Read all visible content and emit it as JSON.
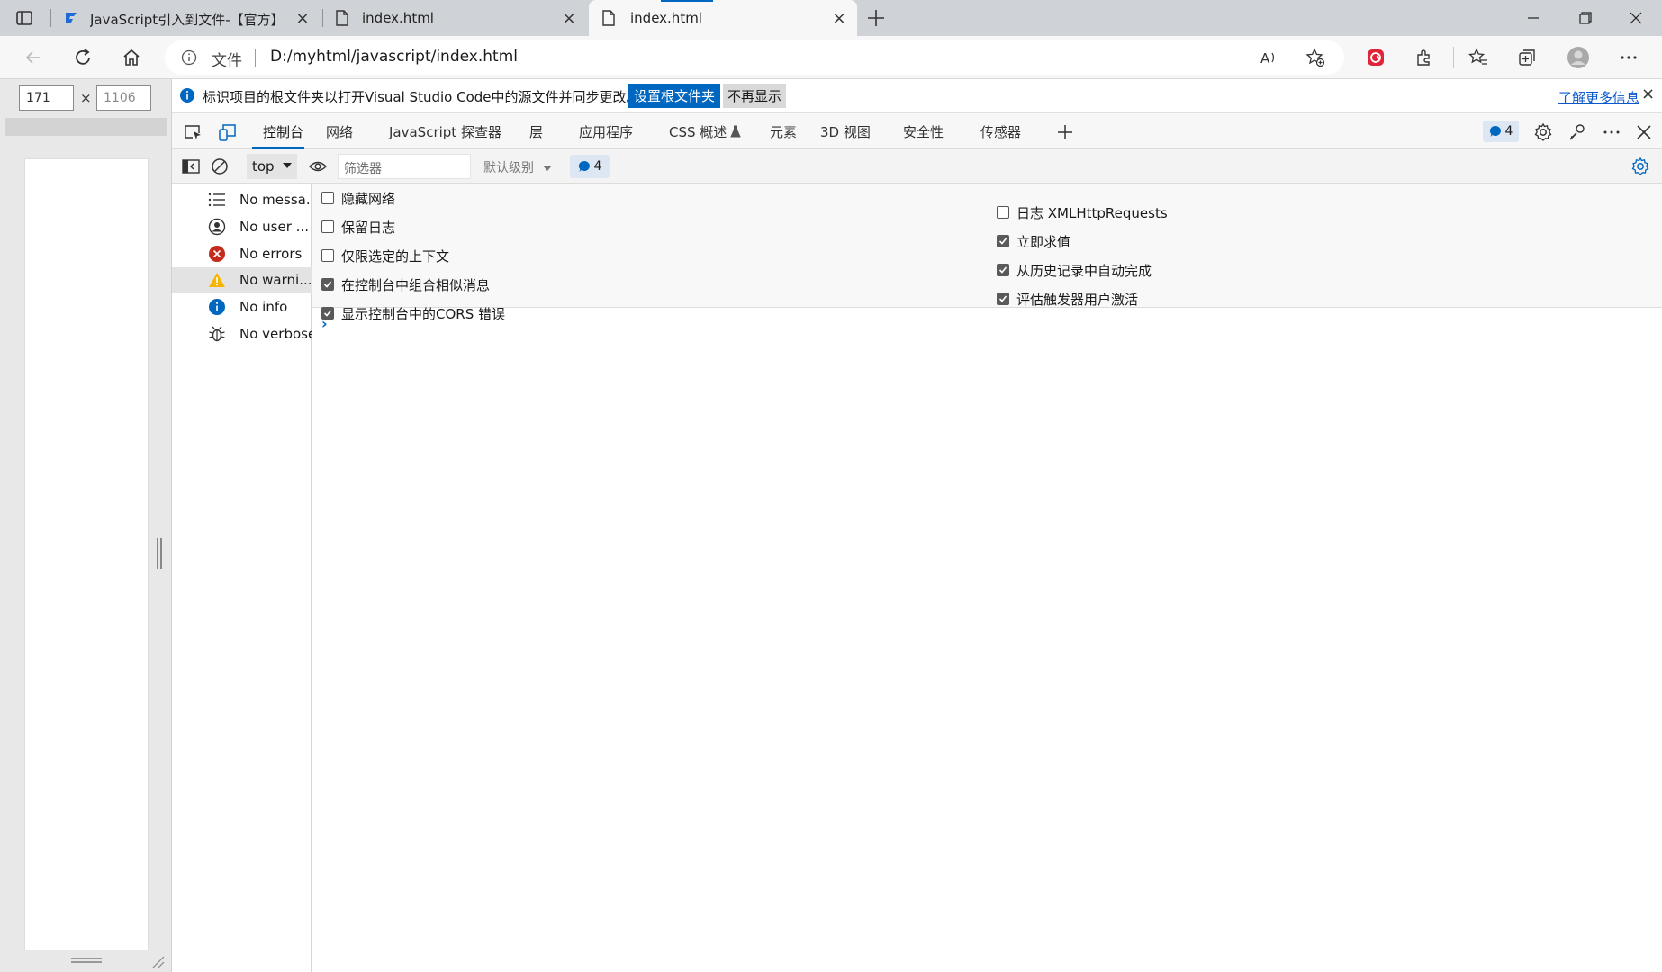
{
  "browser": {
    "tabs": [
      {
        "title": "JavaScript引入到文件-【官方】E",
        "icon": "site-icon"
      },
      {
        "title": "index.html",
        "icon": "document-icon"
      },
      {
        "title": "index.html",
        "icon": "document-icon",
        "active": true
      }
    ],
    "address": {
      "file_label": "文件",
      "url": "D:/myhtml/javascript/index.html"
    }
  },
  "viewport": {
    "width": "171",
    "height": "1106",
    "separator": "×"
  },
  "devtools": {
    "infobar": {
      "message": "标识项目的根文件夹以打开Visual Studio Code中的源文件并同步更改。",
      "set_root_button": "设置根文件夹",
      "dont_show_button": "不再显示",
      "learn_more": "了解更多信息"
    },
    "tabs": [
      {
        "label": "控制台",
        "active": true
      },
      {
        "label": "网络"
      },
      {
        "label": "JavaScript 探查器"
      },
      {
        "label": "层"
      },
      {
        "label": "应用程序"
      },
      {
        "label": "CSS 概述"
      },
      {
        "label": "元素"
      },
      {
        "label": "3D 视图"
      },
      {
        "label": "安全性"
      },
      {
        "label": "传感器"
      }
    ],
    "issues_count": "4",
    "console": {
      "context": "top",
      "filter_placeholder": "筛选器",
      "level": "默认级别",
      "issues_count": "4"
    },
    "sidebar": [
      {
        "label": "No messa...",
        "icon": "list-icon"
      },
      {
        "label": "No user ...",
        "icon": "user-icon"
      },
      {
        "label": "No errors",
        "icon": "error-icon"
      },
      {
        "label": "No warni...",
        "icon": "warning-icon",
        "selected": true
      },
      {
        "label": "No info",
        "icon": "info-icon"
      },
      {
        "label": "No verbose",
        "icon": "bug-icon"
      }
    ],
    "settings_left": [
      {
        "label": "隐藏网络",
        "checked": false
      },
      {
        "label": "保留日志",
        "checked": false
      },
      {
        "label": "仅限选定的上下文",
        "checked": false
      },
      {
        "label": "在控制台中组合相似消息",
        "checked": true
      },
      {
        "label": "显示控制台中的CORS 错误",
        "checked": true
      }
    ],
    "settings_right": [
      {
        "label": "日志 XMLHttpRequests",
        "checked": false
      },
      {
        "label": "立即求值",
        "checked": true
      },
      {
        "label": "从历史记录中自动完成",
        "checked": true
      },
      {
        "label": "评估触发器用户激活",
        "checked": true
      }
    ],
    "prompt": "›"
  },
  "colors": {
    "accent": "#0067c0",
    "error": "#c42b1c",
    "warning": "#f7b500",
    "info": "#0067c0"
  }
}
